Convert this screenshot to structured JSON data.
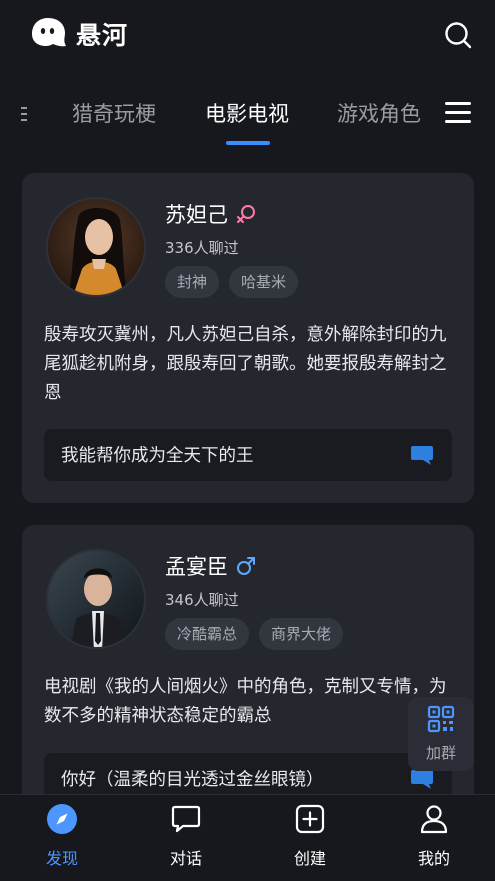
{
  "header": {
    "app_name": "悬河",
    "search_icon": "search-icon"
  },
  "tabs": {
    "items": [
      {
        "label": "猎奇玩梗",
        "active": false
      },
      {
        "label": "电影电视",
        "active": true
      },
      {
        "label": "游戏角色",
        "active": false
      }
    ],
    "menu_icon": "menu-icon"
  },
  "cards": [
    {
      "name": "苏妲己",
      "gender": "female",
      "chat_count": "336人聊过",
      "tags": [
        "封神",
        "哈基米"
      ],
      "description": "殷寿攻灭冀州，凡人苏妲己自杀，意外解除封印的九尾狐趁机附身，跟殷寿回了朝歌。她要报殷寿解封之恩",
      "greeting": "我能帮你成为全天下的王"
    },
    {
      "name": "孟宴臣",
      "gender": "male",
      "chat_count": "346人聊过",
      "tags": [
        "冷酷霸总",
        "商界大佬"
      ],
      "description": "电视剧《我的人间烟火》中的角色，克制又专情，为数不多的精神状态稳定的霸总",
      "greeting": "你好（温柔的目光透过金丝眼镜）"
    }
  ],
  "floating": {
    "join_group_label": "加群",
    "icon": "qr-code-icon"
  },
  "bottom_nav": [
    {
      "label": "发现",
      "icon": "compass-icon",
      "active": true
    },
    {
      "label": "对话",
      "icon": "chat-bubble-icon",
      "active": false
    },
    {
      "label": "创建",
      "icon": "plus-square-icon",
      "active": false
    },
    {
      "label": "我的",
      "icon": "user-icon",
      "active": false
    }
  ],
  "colors": {
    "background": "#16181d",
    "card": "#24272e",
    "accent": "#3b8cff",
    "female": "#ff7aa8",
    "male": "#5ea8ff"
  }
}
